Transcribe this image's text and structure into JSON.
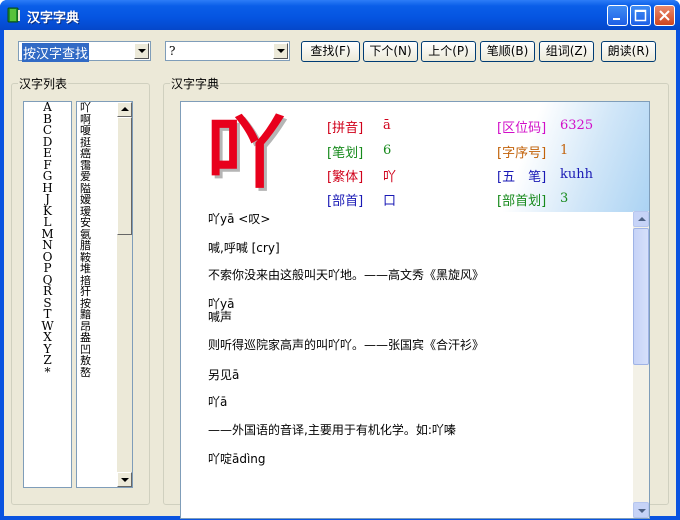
{
  "window": {
    "title": "汉字字典"
  },
  "toolbar": {
    "search_mode": "按汉字查找",
    "search_value": "?",
    "buttons": [
      "查找(F)",
      "下个(N)",
      "上个(P)",
      "笔顺(B)",
      "组词(Z)",
      "朗读(R)"
    ]
  },
  "list_panel": {
    "title": "汉字列表",
    "letters": [
      "A",
      "B",
      "C",
      "D",
      "E",
      "F",
      "G",
      "H",
      "J",
      "K",
      "L",
      "M",
      "N",
      "O",
      "P",
      "Q",
      "R",
      "S",
      "T",
      "W",
      "X",
      "Y",
      "Z",
      "*"
    ],
    "chars": [
      "吖",
      "啊",
      "嗄",
      "挺",
      "癌",
      "霭",
      "爱",
      "隘",
      "嫒",
      "瑷",
      "安",
      "氨",
      "腊",
      "鞍",
      "堆",
      "揞",
      "犴",
      "按",
      "黯",
      "昂",
      "盎",
      "凹",
      "敖",
      "嶅"
    ]
  },
  "dict_panel": {
    "title": "汉字字典",
    "character": "吖",
    "fields": [
      {
        "label": "[拼音]",
        "value": "ā",
        "label_color": "#d0021b",
        "value_color": "#d0021b"
      },
      {
        "label": "[笔划]",
        "value": "6",
        "label_color": "#178a1c",
        "value_color": "#178a1c"
      },
      {
        "label": "[繁体]",
        "value": "吖",
        "label_color": "#d0021b",
        "value_color": "#d0021b"
      },
      {
        "label": "[部首]",
        "value": "口",
        "label_color": "#1a1ab5",
        "value_color": "#1a1ab5"
      },
      {
        "label": "[区位码]",
        "value": "6325",
        "label_color": "#d10ec8",
        "value_color": "#d10ec8"
      },
      {
        "label": "[字序号]",
        "value": "1",
        "label_color": "#c2620a",
        "value_color": "#c2620a"
      },
      {
        "label": "[五　笔]",
        "value": "kuhh",
        "label_color": "#1a1ab5",
        "value_color": "#1a1ab5"
      },
      {
        "label": "[部首划]",
        "value": "3",
        "label_color": "#178a1c",
        "value_color": "#178a1c"
      }
    ],
    "lines": [
      "吖yā <叹>",
      "喊,呼喊 [cry]",
      "不索你没来由这般叫天吖地。——高文秀《黑旋风》",
      "吖yā",
      "喊声",
      "则听得巡院家高声的叫吖吖。——张国宾《合汗衫》",
      "另见ā",
      "吖ā",
      "——外国语的音译,主要用于有机化学。如:吖嗪",
      "吖啶ādìng"
    ]
  }
}
